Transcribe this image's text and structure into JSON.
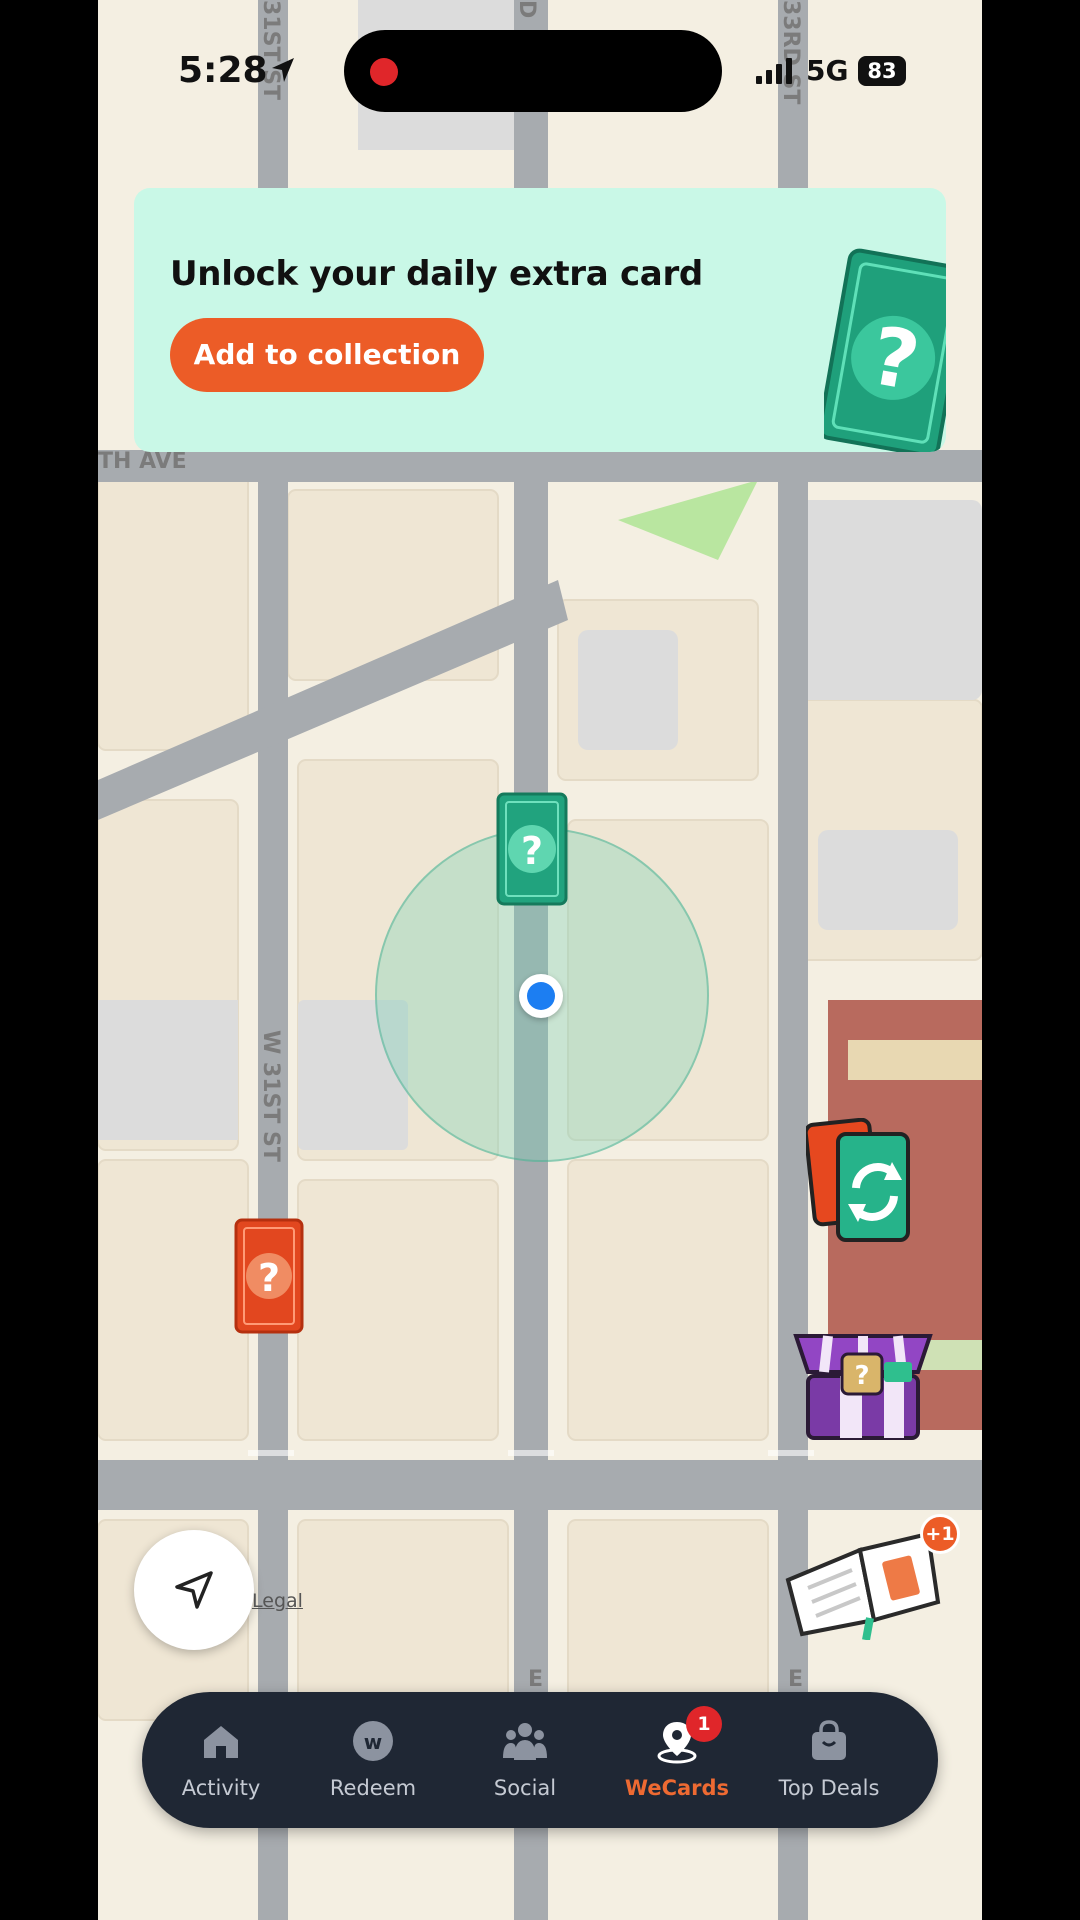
{
  "status_bar": {
    "time": "5:28",
    "network": "5G",
    "battery": "83",
    "icons": [
      "location-arrow-icon",
      "recording-dot-icon",
      "signal-bars-icon",
      "battery-icon"
    ]
  },
  "banner": {
    "title": "Unlock your daily extra card",
    "button_label": "Add to collection",
    "art_icon": "mystery-card-icon"
  },
  "map": {
    "street_labels": [
      "31ST ST",
      "33RD ST",
      "TH AVE",
      "W 31ST ST",
      "E",
      "D"
    ],
    "legal_label": "Legal",
    "markers": [
      "green-mystery-card",
      "red-mystery-card",
      "user-location"
    ]
  },
  "floating_buttons": {
    "swap_icon": "card-swap-icon",
    "shop_icon": "deal-shop-icon",
    "book_icon": "collection-book-icon",
    "book_badge": "+1",
    "recenter_icon": "navigation-arrow-icon"
  },
  "bottom_nav": {
    "items": [
      {
        "label": "Activity",
        "icon": "home-icon"
      },
      {
        "label": "Redeem",
        "icon": "w-coin-icon"
      },
      {
        "label": "Social",
        "icon": "people-icon"
      },
      {
        "label": "WeCards",
        "icon": "map-pin-icon"
      },
      {
        "label": "Top Deals",
        "icon": "shopping-bag-icon"
      }
    ],
    "active_index": 3,
    "wecards_badge": "1"
  },
  "colors": {
    "accent": "#ec5c27",
    "banner_bg": "#c9f8e7",
    "nav_bg": "#1f2734",
    "user_dot": "#1c7ef2"
  }
}
